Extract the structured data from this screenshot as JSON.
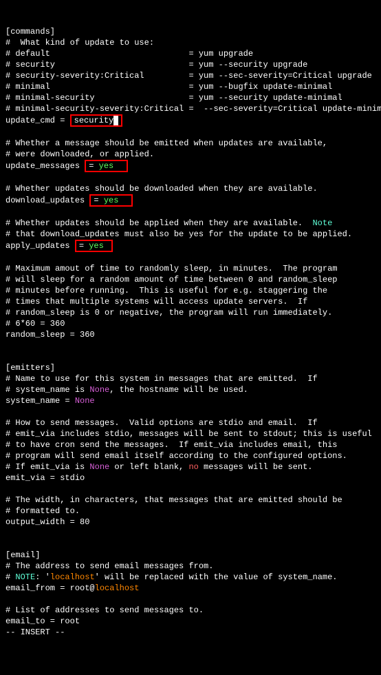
{
  "section_commands": "[commands]",
  "c1": "#  What kind of update to use:",
  "c2": "# default                            = yum upgrade",
  "c3": "# security                           = yum --security upgrade",
  "c4": "# security-severity:Critical         = yum --sec-severity=Critical upgrade",
  "c5": "# minimal                            = yum --bugfix update-minimal",
  "c6": "# minimal-security                   = yum --security update-minimal",
  "c7": "# minimal-security-severity:Critical =  --sec-severity=Critical update-minima",
  "update_cmd_key": "update_cmd = ",
  "update_cmd_val": "security",
  "c8a": "# Whether a message should be emitted when updates are available,",
  "c8b": "# were downloaded, or applied.",
  "update_messages_key": "update_messages ",
  "update_messages_eq": "= ",
  "update_messages_val": "yes",
  "c9": "# Whether updates should be downloaded when they are available.",
  "download_updates_key": "download_updates ",
  "download_updates_eq": "= ",
  "download_updates_val": "yes",
  "c10a": "# Whether updates should be applied when they are available.  ",
  "c10a_note": "Note",
  "c10b": "# that download_updates must also be yes for the update to be applied.",
  "apply_updates_key": "apply_updates ",
  "apply_updates_eq": "= ",
  "apply_updates_val": "yes",
  "c11a": "# Maximum amout of time to randomly sleep, in minutes.  The program",
  "c11b": "# will sleep for a random amount of time between 0 and random_sleep",
  "c11c": "# minutes before running.  This is useful for e.g. staggering the",
  "c11d": "# times that multiple systems will access update servers.  If",
  "c11e": "# random_sleep is 0 or negative, the program will run immediately.",
  "c11f": "# 6*60 = 360",
  "random_sleep": "random_sleep = 360",
  "section_emitters": "[emitters]",
  "c12a": "# Name to use for this system in messages that are emitted.  If",
  "c12b1": "# system_name is ",
  "c12b_none": "None",
  "c12b2": ", the hostname will be used.",
  "system_name_key": "system_name = ",
  "system_name_val": "None",
  "c13a": "# How to send messages.  Valid options are stdio and email.  If",
  "c13b": "# emit_via includes stdio, messages will be sent to stdout; this is useful",
  "c13c": "# to have cron send the messages.  If emit_via includes email, this",
  "c13d": "# program will send email itself according to the configured options.",
  "c13e1": "# If emit_via is ",
  "c13e_none": "None",
  "c13e2": " or left blank, ",
  "c13e_no": "no",
  "c13e3": " messages will be sent.",
  "emit_via": "emit_via = stdio",
  "c14a": "# The width, in characters, that messages that are emitted should be",
  "c14b": "# formatted to.",
  "output_width": "output_width = 80",
  "section_email": "[email]",
  "c15": "# The address to send email messages from.",
  "c16a": "# ",
  "c16_note": "NOTE",
  "c16b": ": '",
  "c16_localhost": "localhost",
  "c16c": "' will be replaced with the value of system_name.",
  "email_from_key": "email_from = root@",
  "email_from_val": "localhost",
  "c17": "# List of addresses to send messages to.",
  "email_to": "email_to = root",
  "mode": "-- INSERT --"
}
